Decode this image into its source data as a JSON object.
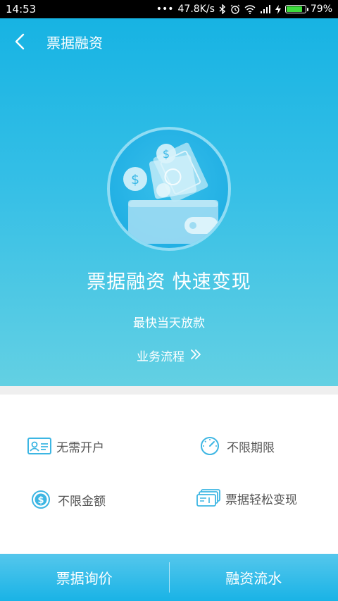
{
  "status": {
    "time": "14:53",
    "network_speed": "47.8K/s",
    "battery": "79%",
    "battery_level": 0.79
  },
  "nav": {
    "title": "票据融资"
  },
  "hero": {
    "headline": "票据融资 快速变现",
    "subline": "最快当天放款",
    "process_link": "业务流程"
  },
  "features": [
    {
      "label": "无需开户",
      "icon": "id-card-icon"
    },
    {
      "label": "不限期限",
      "icon": "speedometer-icon"
    },
    {
      "label": "不限金额",
      "icon": "dollar-coin-icon"
    },
    {
      "label": "票据轻松变现",
      "icon": "bill-stack-icon"
    }
  ],
  "bottom": {
    "left_label": "票据询价",
    "right_label": "融资流水"
  },
  "colors": {
    "accent": "#19b3e6",
    "icon": "#3db6e3"
  }
}
